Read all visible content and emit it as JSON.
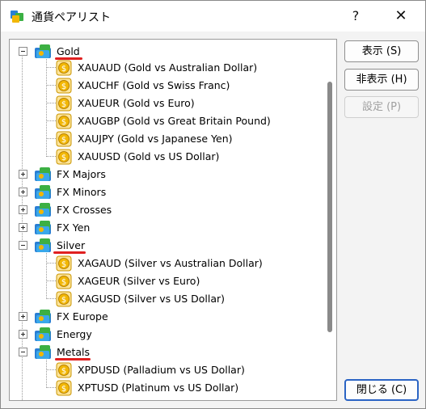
{
  "window": {
    "title": "通貨ペアリスト",
    "help_glyph": "?",
    "close_glyph": "✕"
  },
  "buttons": {
    "show": "表示 (S)",
    "hide": "非表示 (H)",
    "settings": "設定 (P)",
    "close": "閉じる (C)"
  },
  "tree": {
    "gold": {
      "label": "Gold",
      "items": [
        "XAUAUD  (Gold vs Australian Dollar)",
        "XAUCHF  (Gold vs Swiss Franc)",
        "XAUEUR  (Gold vs Euro)",
        "XAUGBP  (Gold vs Great Britain Pound)",
        "XAUJPY  (Gold vs Japanese Yen)",
        "XAUUSD  (Gold vs US Dollar)"
      ]
    },
    "fx_majors": {
      "label": "FX Majors"
    },
    "fx_minors": {
      "label": "FX Minors"
    },
    "fx_crosses": {
      "label": "FX Crosses"
    },
    "fx_yen": {
      "label": "FX Yen"
    },
    "silver": {
      "label": "Silver",
      "items": [
        "XAGAUD  (Silver vs Australian Dollar)",
        "XAGEUR  (Silver vs Euro)",
        "XAGUSD  (Silver vs US Dollar)"
      ]
    },
    "fx_europe": {
      "label": "FX Europe"
    },
    "energy": {
      "label": "Energy"
    },
    "metals": {
      "label": "Metals",
      "items": [
        "XPDUSD  (Palladium vs US Dollar)",
        "XPTUSD  (Platinum vs US Dollar)"
      ]
    }
  },
  "colors": {
    "highlight_underline": "#e02020",
    "folder_blue": "#2a7fd4",
    "folder_green": "#3cb043",
    "coin_gold": "#f2b705",
    "primary_border": "#2b64c4"
  }
}
